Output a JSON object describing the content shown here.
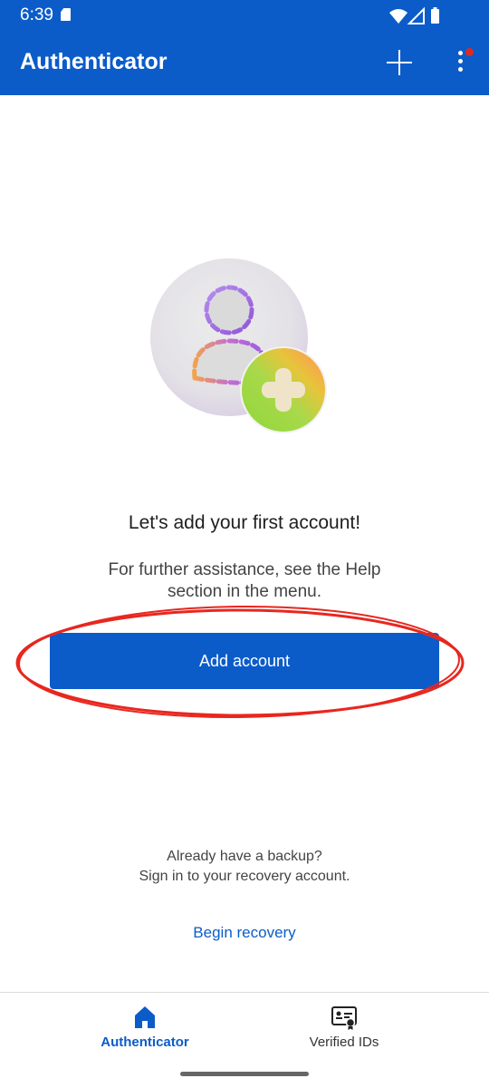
{
  "status_bar": {
    "time": "6:39"
  },
  "header": {
    "title": "Authenticator",
    "add_icon": "plus-icon",
    "more_icon": "more-vertical-icon"
  },
  "main": {
    "illustration_icon": "add-person-icon",
    "headline": "Let's add your first account!",
    "help_text": "For further assistance, see the Help section in the menu.",
    "add_account_label": "Add account",
    "backup_line1": "Already have a backup?",
    "backup_line2": "Sign in to your recovery account.",
    "begin_recovery_label": "Begin recovery"
  },
  "bottom_nav": {
    "items": [
      {
        "label": "Authenticator",
        "icon": "home-icon",
        "selected": true
      },
      {
        "label": "Verified IDs",
        "icon": "id-card-icon",
        "selected": false
      }
    ]
  },
  "colors": {
    "brand": "#0b5cc9",
    "annotation": "#e8271f",
    "notification_badge": "#e0281e"
  }
}
